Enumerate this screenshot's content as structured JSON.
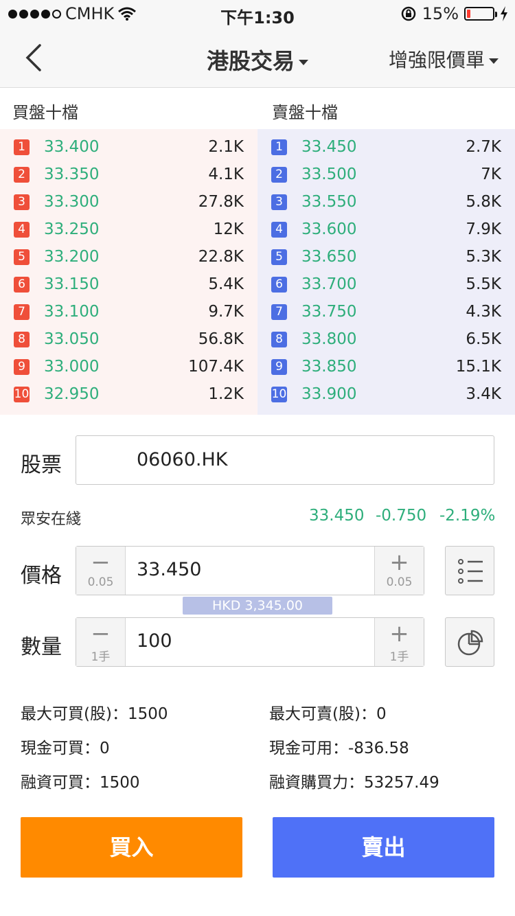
{
  "status_bar": {
    "carrier": "CMHK",
    "time": "下午1:30",
    "battery": "15%",
    "battery_level": 0.15
  },
  "nav": {
    "title": "港股交易",
    "order_type": "增強限價單"
  },
  "order_book": {
    "bid_header": "買盤十檔",
    "ask_header": "賣盤十檔",
    "bids": [
      {
        "level": "1",
        "price": "33.400",
        "volume": "2.1K"
      },
      {
        "level": "2",
        "price": "33.350",
        "volume": "4.1K"
      },
      {
        "level": "3",
        "price": "33.300",
        "volume": "27.8K"
      },
      {
        "level": "4",
        "price": "33.250",
        "volume": "12K"
      },
      {
        "level": "5",
        "price": "33.200",
        "volume": "22.8K"
      },
      {
        "level": "6",
        "price": "33.150",
        "volume": "5.4K"
      },
      {
        "level": "7",
        "price": "33.100",
        "volume": "9.7K"
      },
      {
        "level": "8",
        "price": "33.050",
        "volume": "56.8K"
      },
      {
        "level": "9",
        "price": "33.000",
        "volume": "107.4K"
      },
      {
        "level": "10",
        "price": "32.950",
        "volume": "1.2K"
      }
    ],
    "asks": [
      {
        "level": "1",
        "price": "33.450",
        "volume": "2.7K"
      },
      {
        "level": "2",
        "price": "33.500",
        "volume": "7K"
      },
      {
        "level": "3",
        "price": "33.550",
        "volume": "5.8K"
      },
      {
        "level": "4",
        "price": "33.600",
        "volume": "7.9K"
      },
      {
        "level": "5",
        "price": "33.650",
        "volume": "5.3K"
      },
      {
        "level": "6",
        "price": "33.700",
        "volume": "5.5K"
      },
      {
        "level": "7",
        "price": "33.750",
        "volume": "4.3K"
      },
      {
        "level": "8",
        "price": "33.800",
        "volume": "6.5K"
      },
      {
        "level": "9",
        "price": "33.850",
        "volume": "15.1K"
      },
      {
        "level": "10",
        "price": "33.900",
        "volume": "3.4K"
      }
    ]
  },
  "form": {
    "stock_label": "股票",
    "stock_code": "06060.HK",
    "stock_name": "眾安在綫",
    "last_price": "33.450",
    "change": "-0.750",
    "change_pct": "-2.19%",
    "price_label": "價格",
    "price_value": "33.450",
    "price_step": "0.05",
    "amount": "HKD 3,345.00",
    "qty_label": "數量",
    "qty_value": "100",
    "qty_step": "1手"
  },
  "account": {
    "max_buy": "最大可買(股)：1500",
    "max_sell": "最大可賣(股)：0",
    "cash_buy": "現金可買：0",
    "cash_avail": "現金可用：-836.58",
    "margin_buy": "融資可買：1500",
    "buying_power": "融資購買力：53257.49"
  },
  "actions": {
    "buy": "買入",
    "sell": "賣出"
  },
  "colors": {
    "buy": "#ff8a00",
    "sell": "#4f71f7",
    "price_green": "#2eae7b",
    "bid_badge": "#ef4f3a",
    "ask_badge": "#4c6ee3"
  }
}
